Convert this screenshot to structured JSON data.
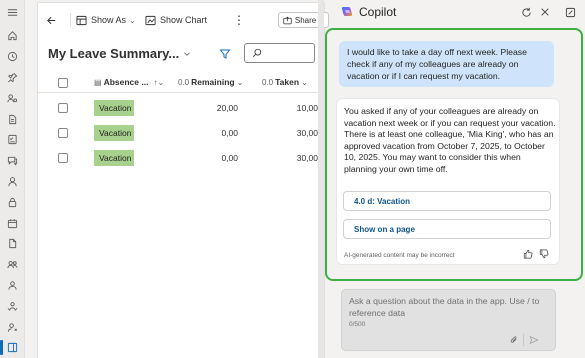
{
  "toolbar": {
    "back_icon": "arrow-left-icon",
    "show_as_label": "Show As",
    "show_chart_label": "Show Chart",
    "share_label": "Share"
  },
  "page": {
    "title": "My Leave Summary...",
    "search": {
      "placeholder": ""
    }
  },
  "grid": {
    "headers": {
      "absence_code": "Absence ...",
      "remaining": "Remaining",
      "taken": "Taken",
      "remaining_prefix": "0.0",
      "taken_prefix": "0.0"
    },
    "rows": [
      {
        "absence_code": "Vacation",
        "remaining": "20,00",
        "taken": "10,00"
      },
      {
        "absence_code": "Vacation",
        "remaining": "0,00",
        "taken": "30,00"
      },
      {
        "absence_code": "Vacation",
        "remaining": "0,00",
        "taken": "30,00"
      }
    ]
  },
  "copilot": {
    "title": "Copilot",
    "user_message": "I would like to take a day off next week. Please check if any of my colleagues are already on vacation or if I can request my vacation.",
    "ai_response": "You asked if any of your colleagues are already on vacation next week or if you can request your vacation. There is at least one colleague, 'Mia King', who has an approved vacation from October 7, 2025, to October 10, 2025. You may want to consider this when planning your own time off.",
    "reference_button": "4.0 d: Vacation",
    "show_on_page_button": "Show on a page",
    "disclaimer": "AI-generated content may be incorrect",
    "input_placeholder": "Ask a question about the data in the app. Use / to reference data",
    "char_count": "0/500"
  },
  "colors": {
    "accent": "#0f6cbd",
    "highlight_border": "#3cb043",
    "vacation_badge": "#a9d18e",
    "user_bubble": "#cfe4fa"
  }
}
